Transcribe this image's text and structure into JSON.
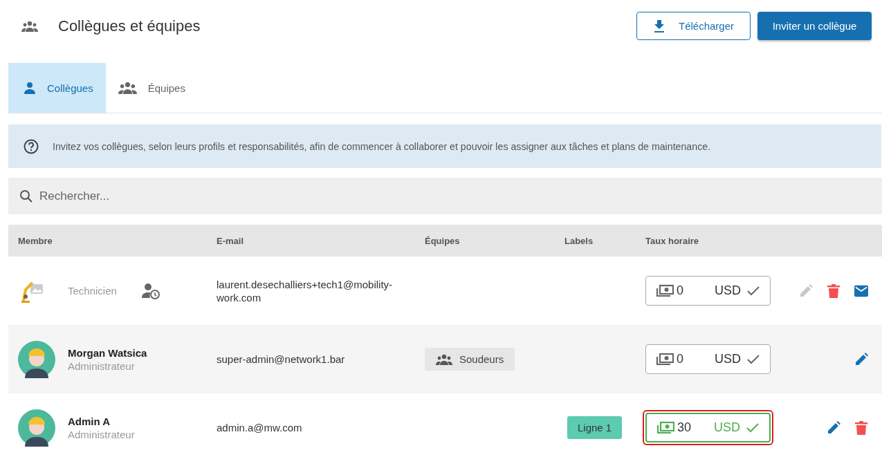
{
  "header": {
    "title": "Collègues et équipes",
    "buttons": [
      {
        "label": "Télécharger",
        "kind": "outline"
      },
      {
        "label": "Inviter un collègue",
        "kind": "primary"
      }
    ]
  },
  "tabs": [
    {
      "label": "Collègues",
      "kind": "person",
      "selected": true
    },
    {
      "label": "Équipes",
      "kind": "group",
      "selected": false
    }
  ],
  "info": {
    "text": "Invitez vos collègues, selon leurs profils et responsabilités, afin de commencer à collaborer et pouvoir les assigner aux tâches et plans de maintenance."
  },
  "search": {
    "placeholder": "Rechercher..."
  },
  "table": {
    "columns": [
      "Membre",
      "E-mail",
      "Équipes",
      "Labels",
      "Taux horaire"
    ],
    "rows": [
      {
        "kind": "image",
        "role": "Technicien",
        "pending": true,
        "email": "laurent.desechalliers+tech1@mobility-work.com",
        "rate": {
          "value": "0",
          "currency": "USD",
          "highlighted": false
        },
        "actions": [
          {
            "kind": "edit",
            "disabled": true
          },
          {
            "kind": "delete",
            "disabled": false
          },
          {
            "kind": "mail",
            "disabled": false
          }
        ]
      },
      {
        "kind": "person",
        "name": "Morgan Watsica",
        "role": "Administrateur",
        "pending": false,
        "email": "super-admin@network1.bar",
        "teams": [
          "Soudeurs"
        ],
        "rate": {
          "value": "0",
          "currency": "USD",
          "highlighted": false
        },
        "actions": [
          {
            "kind": "edit",
            "disabled": false
          }
        ]
      },
      {
        "kind": "person",
        "name": "Admin A",
        "role": "Administrateur",
        "pending": false,
        "email": "admin.a@mw.com",
        "labels": [
          {
            "text": "Ligne 1",
            "color": "#5ccbb0"
          }
        ],
        "rate": {
          "value": "30",
          "currency": "USD",
          "highlighted": true
        },
        "actions": [
          {
            "kind": "edit",
            "disabled": false
          },
          {
            "kind": "delete",
            "disabled": false
          }
        ]
      }
    ]
  }
}
